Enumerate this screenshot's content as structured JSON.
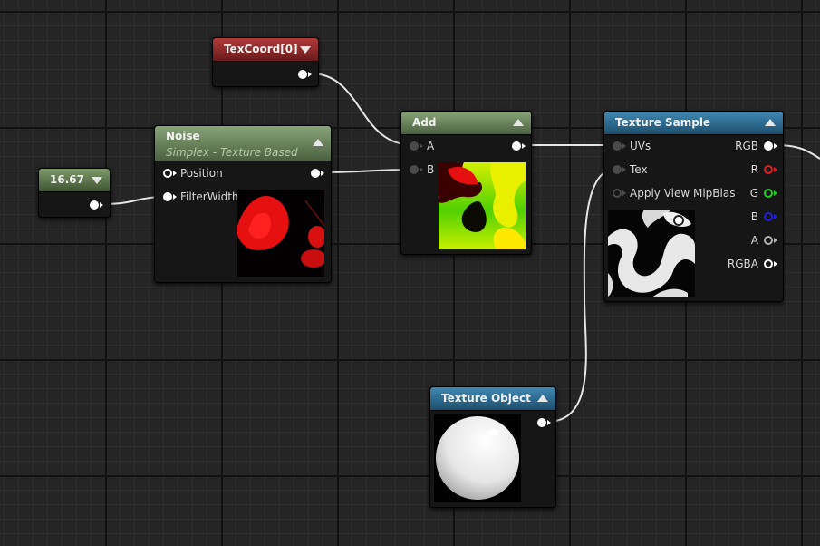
{
  "nodes": {
    "texcoord": {
      "title": "TexCoord[0]"
    },
    "constant": {
      "title": "16.67"
    },
    "noise": {
      "title": "Noise",
      "subtitle": "Simplex - Texture Based",
      "inputs": [
        "Position",
        "FilterWidth"
      ]
    },
    "add": {
      "title": "Add",
      "inputs": [
        "A",
        "B"
      ]
    },
    "texture_sample": {
      "title": "Texture Sample",
      "inputs": [
        "UVs",
        "Tex",
        "Apply View MipBias"
      ],
      "outputs": [
        "RGB",
        "R",
        "G",
        "B",
        "A",
        "RGBA"
      ]
    },
    "texture_object": {
      "title": "Texture Object"
    }
  },
  "pin_colors": {
    "white": "#ffffff",
    "r": "#e02020",
    "g": "#20d020",
    "b": "#2020e0",
    "a": "#b0b0b0"
  },
  "header_colors": {
    "constant": "#5e7a4b",
    "noise": "#6b8560",
    "texcoord": "#9a2a2a",
    "texture": "#2d6f96"
  }
}
